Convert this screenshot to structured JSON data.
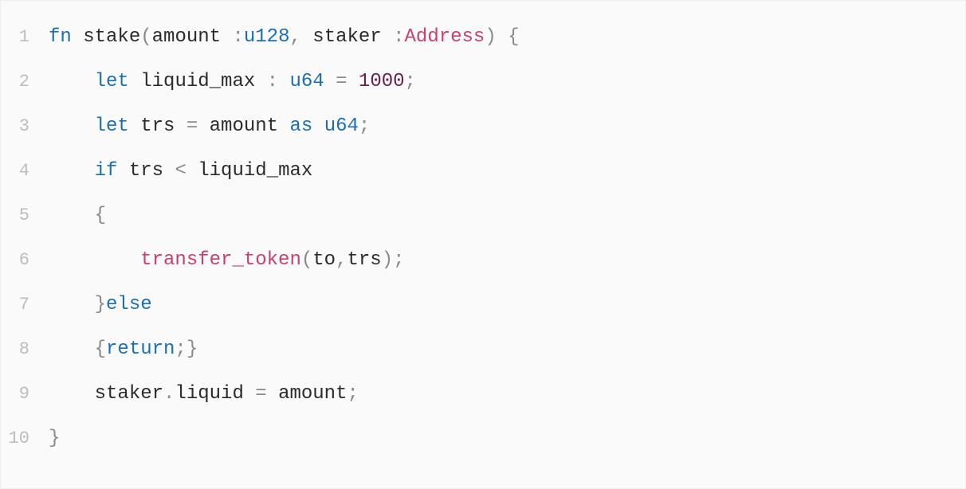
{
  "code": {
    "lines": [
      {
        "num": "1",
        "indent": "",
        "tokens": [
          {
            "cls": "tok-kw",
            "t": "fn"
          },
          {
            "cls": "tok-ident",
            "t": " "
          },
          {
            "cls": "tok-ident",
            "t": "stake"
          },
          {
            "cls": "tok-punc",
            "t": "("
          },
          {
            "cls": "tok-ident",
            "t": "amount "
          },
          {
            "cls": "tok-punc",
            "t": ":"
          },
          {
            "cls": "tok-type",
            "t": "u128"
          },
          {
            "cls": "tok-punc",
            "t": ","
          },
          {
            "cls": "tok-ident",
            "t": " staker "
          },
          {
            "cls": "tok-punc",
            "t": ":"
          },
          {
            "cls": "tok-class",
            "t": "Address"
          },
          {
            "cls": "tok-punc",
            "t": ")"
          },
          {
            "cls": "tok-ident",
            "t": " "
          },
          {
            "cls": "tok-punc",
            "t": "{"
          }
        ]
      },
      {
        "num": "2",
        "indent": "    ",
        "tokens": [
          {
            "cls": "tok-kw",
            "t": "let"
          },
          {
            "cls": "tok-ident",
            "t": " "
          },
          {
            "cls": "tok-ident",
            "t": "liquid_max "
          },
          {
            "cls": "tok-punc",
            "t": ":"
          },
          {
            "cls": "tok-ident",
            "t": " "
          },
          {
            "cls": "tok-type",
            "t": "u64"
          },
          {
            "cls": "tok-ident",
            "t": " "
          },
          {
            "cls": "tok-op",
            "t": "="
          },
          {
            "cls": "tok-ident",
            "t": " "
          },
          {
            "cls": "tok-num",
            "t": "1000"
          },
          {
            "cls": "tok-punc",
            "t": ";"
          }
        ]
      },
      {
        "num": "3",
        "indent": "    ",
        "tokens": [
          {
            "cls": "tok-kw",
            "t": "let"
          },
          {
            "cls": "tok-ident",
            "t": " "
          },
          {
            "cls": "tok-ident",
            "t": "trs "
          },
          {
            "cls": "tok-op",
            "t": "="
          },
          {
            "cls": "tok-ident",
            "t": " amount "
          },
          {
            "cls": "tok-kw",
            "t": "as"
          },
          {
            "cls": "tok-ident",
            "t": " "
          },
          {
            "cls": "tok-type",
            "t": "u64"
          },
          {
            "cls": "tok-punc",
            "t": ";"
          }
        ]
      },
      {
        "num": "4",
        "indent": "    ",
        "tokens": [
          {
            "cls": "tok-kw",
            "t": "if"
          },
          {
            "cls": "tok-ident",
            "t": " "
          },
          {
            "cls": "tok-ident",
            "t": "trs "
          },
          {
            "cls": "tok-op",
            "t": "<"
          },
          {
            "cls": "tok-ident",
            "t": " liquid_max"
          }
        ]
      },
      {
        "num": "5",
        "indent": "    ",
        "tokens": [
          {
            "cls": "tok-punc",
            "t": "{"
          }
        ]
      },
      {
        "num": "6",
        "indent": "        ",
        "tokens": [
          {
            "cls": "tok-class",
            "t": "transfer_token"
          },
          {
            "cls": "tok-punc",
            "t": "("
          },
          {
            "cls": "tok-ident",
            "t": "to"
          },
          {
            "cls": "tok-punc",
            "t": ","
          },
          {
            "cls": "tok-ident",
            "t": "trs"
          },
          {
            "cls": "tok-punc",
            "t": ")"
          },
          {
            "cls": "tok-punc",
            "t": ";"
          }
        ]
      },
      {
        "num": "7",
        "indent": "    ",
        "tokens": [
          {
            "cls": "tok-punc",
            "t": "}"
          },
          {
            "cls": "tok-kw",
            "t": "else"
          }
        ]
      },
      {
        "num": "8",
        "indent": "    ",
        "tokens": [
          {
            "cls": "tok-punc",
            "t": "{"
          },
          {
            "cls": "tok-kw",
            "t": "return"
          },
          {
            "cls": "tok-punc",
            "t": ";"
          },
          {
            "cls": "tok-punc",
            "t": "}"
          }
        ]
      },
      {
        "num": "9",
        "indent": "    ",
        "tokens": [
          {
            "cls": "tok-ident",
            "t": "staker"
          },
          {
            "cls": "tok-op",
            "t": "."
          },
          {
            "cls": "tok-ident",
            "t": "liquid "
          },
          {
            "cls": "tok-op",
            "t": "="
          },
          {
            "cls": "tok-ident",
            "t": " amount"
          },
          {
            "cls": "tok-punc",
            "t": ";"
          }
        ]
      },
      {
        "num": "10",
        "indent": "",
        "tokens": [
          {
            "cls": "tok-punc",
            "t": "}"
          }
        ]
      }
    ]
  }
}
